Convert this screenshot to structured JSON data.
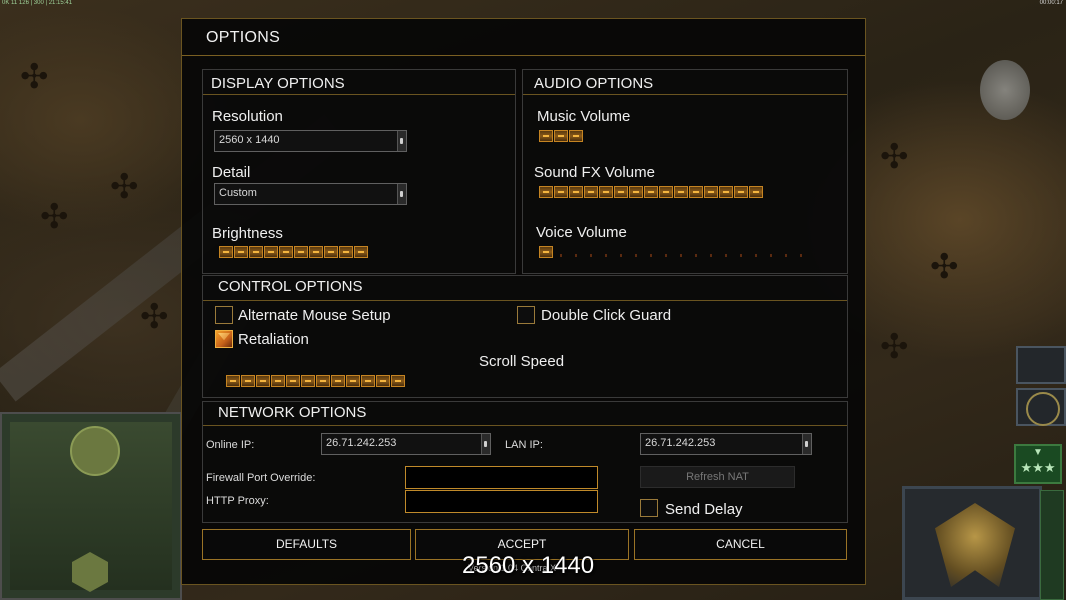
{
  "topbar": {
    "left_text": "0K 11 126 | 300 | 21:15:41",
    "right_text": "00:00:17"
  },
  "window": {
    "title": "OPTIONS"
  },
  "display": {
    "heading": "DISPLAY OPTIONS",
    "resolution_label": "Resolution",
    "resolution_value": "2560 x 1440",
    "detail_label": "Detail",
    "detail_value": "Custom",
    "brightness_label": "Brightness",
    "brightness_level": 10
  },
  "audio": {
    "heading": "AUDIO OPTIONS",
    "music_label": "Music Volume",
    "music_level": 3,
    "sfx_label": "Sound FX Volume",
    "sfx_level": 15,
    "voice_label": "Voice Volume",
    "voice_level": 1
  },
  "control": {
    "heading": "CONTROL OPTIONS",
    "alt_mouse_label": "Alternate Mouse Setup",
    "alt_mouse_checked": false,
    "double_click_label": "Double Click Guard",
    "double_click_checked": false,
    "retaliation_label": "Retaliation",
    "retaliation_checked": true,
    "scroll_speed_label": "Scroll Speed",
    "scroll_speed_level": 12
  },
  "network": {
    "heading": "NETWORK OPTIONS",
    "online_ip_label": "Online IP:",
    "online_ip_value": "26.71.242.253",
    "lan_ip_label": "LAN IP:",
    "lan_ip_value": "26.71.242.253",
    "firewall_label": "Firewall Port Override:",
    "firewall_value": "",
    "proxy_label": "HTTP Proxy:",
    "proxy_value": "",
    "refresh_nat_label": "Refresh NAT",
    "send_delay_label": "Send Delay",
    "send_delay_checked": false
  },
  "buttons": {
    "defaults": "DEFAULTS",
    "accept": "ACCEPT",
    "cancel": "CANCEL"
  },
  "version_text": "Version 1.04 Contra X",
  "overlay_resolution": "2560 x 1440",
  "rank_stars": "★★★"
}
